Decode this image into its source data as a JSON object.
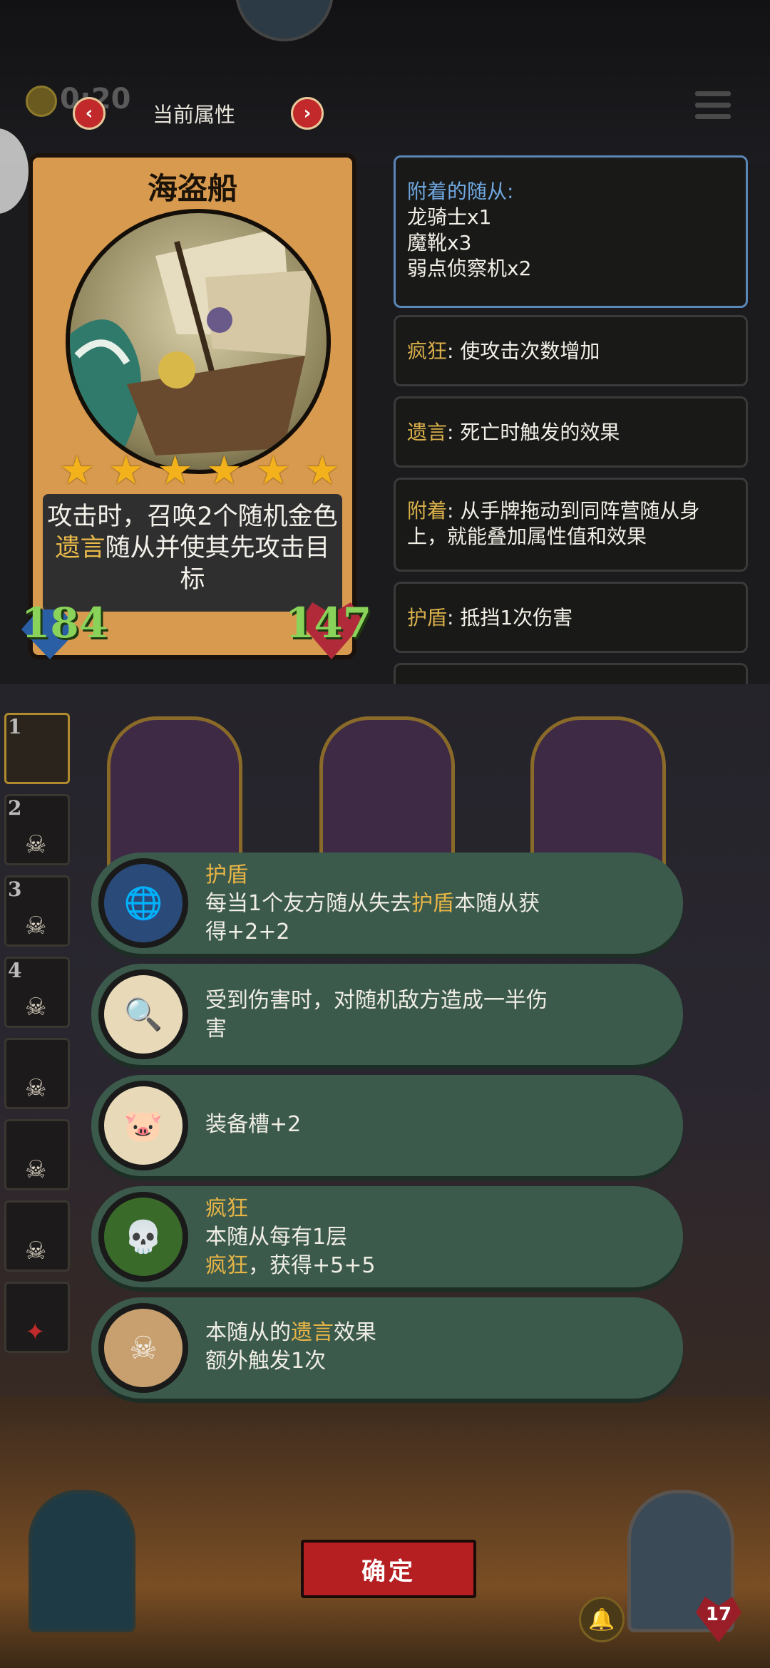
{
  "header": {
    "coin_value": "0:20",
    "title": "当前属性",
    "prev_arrow": "‹",
    "next_arrow": "›"
  },
  "card": {
    "name": "海盗船",
    "stars": 6,
    "desc_pre": "攻击时，召唤2个随机金色",
    "desc_keyword": "遗言",
    "desc_post": "随从并使其先攻击目标",
    "attack": "184",
    "health": "147"
  },
  "info": {
    "attached_title": "附着的随从:",
    "attached": [
      "龙骑士x1",
      "魔靴x3",
      "弱点侦察机x2"
    ],
    "keywords": [
      {
        "name": "疯狂",
        "desc": ": 使攻击次数增加"
      },
      {
        "name": "遗言",
        "desc": ": 死亡时触发的效果"
      },
      {
        "name": "附着",
        "desc": ": 从手牌拖动到同阵营随从身上，就能叠加属性值和效果"
      },
      {
        "name": "护盾",
        "desc": ": 抵挡1次伤害"
      }
    ]
  },
  "slots": [
    "1",
    "2",
    "3",
    "4",
    "",
    "",
    "",
    ""
  ],
  "abilities": [
    {
      "icon": "globe-shield-icon",
      "title": "护盾",
      "l1a": "每当1个友方随从失去",
      "l1k": "护盾",
      "l1b": "本随从获",
      "l2": "得+2+2"
    },
    {
      "icon": "magnifier-icon",
      "title": "",
      "l1a": "受到伤害时，对随机敌方造成一半伤",
      "l1k": "",
      "l1b": "",
      "l2": "害"
    },
    {
      "icon": "pig-icon",
      "title": "",
      "l1a": "装备槽+2",
      "l1k": "",
      "l1b": "",
      "l2": ""
    },
    {
      "icon": "flame-skull-icon",
      "title": "疯狂",
      "l1a": "本随从每有1层",
      "l1k": "",
      "l1b": "",
      "l2k": "疯狂",
      "l2": "，获得+5+5"
    },
    {
      "icon": "scroll-skull-icon",
      "title": "",
      "l1a": "本随从的",
      "l1k": "遗言",
      "l1b": "效果",
      "l2": "额外触发1次"
    }
  ],
  "confirm_label": "确定",
  "hero_hp": "17"
}
